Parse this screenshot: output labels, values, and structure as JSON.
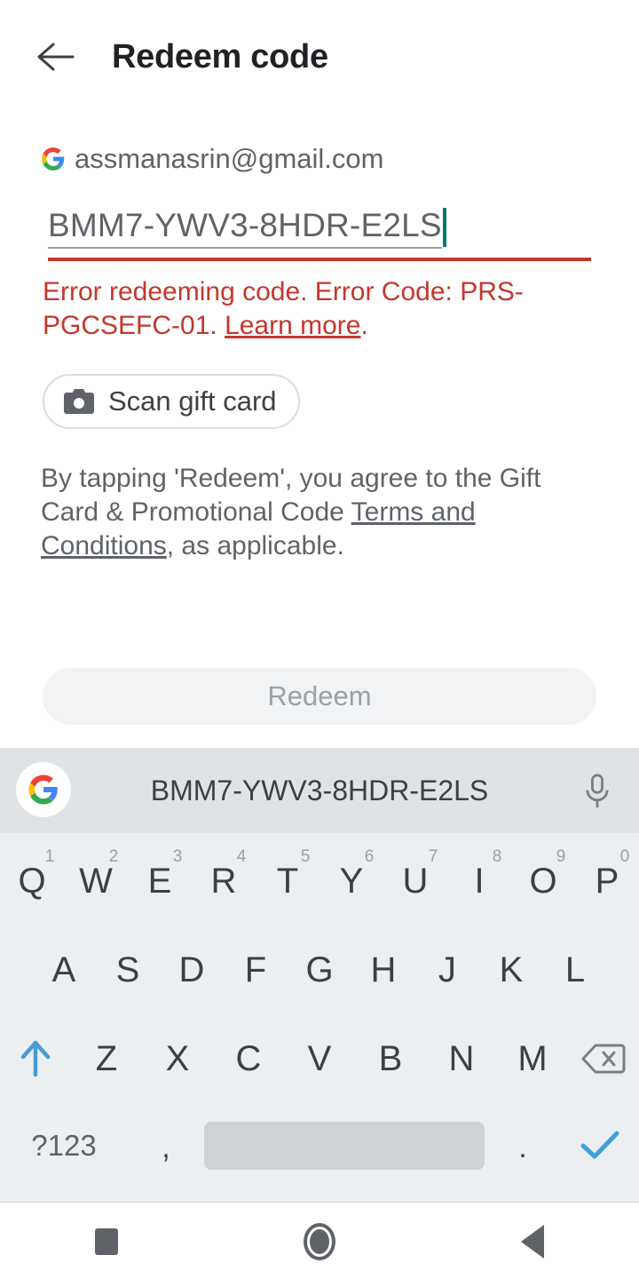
{
  "appbar": {
    "back_icon": "arrow-back-icon",
    "title": "Redeem code"
  },
  "account": {
    "logo": "google-g-icon",
    "email": "assmanasrin@gmail.com"
  },
  "code_field": {
    "value": "BMM7-YWV3-8HDR-E2LS",
    "placeholder": "Enter code",
    "caret_color": "#00796b",
    "error_underline_color": "#c5372c"
  },
  "error": {
    "message_before_link": "Error redeeming code. Error Code: PRS-PGCSEFC-01. ",
    "link_label": "Learn more",
    "message_after_link": ".",
    "color": "#c5372c"
  },
  "scan_button": {
    "icon": "camera-icon",
    "label": "Scan gift card"
  },
  "terms": {
    "text_before_link": "By tapping 'Redeem', you agree to the Gift Card & Promotional Code ",
    "link_label": "Terms and Conditions",
    "text_after_link": ", as applicable."
  },
  "redeem_button": {
    "label": "Redeem",
    "enabled": "false"
  },
  "keyboard": {
    "suggestion": "BMM7-YWV3-8HDR-E2LS",
    "logo": "google-g-icon",
    "mic_icon": "microphone-icon",
    "row1": [
      {
        "key": "Q",
        "num": "1"
      },
      {
        "key": "W",
        "num": "2"
      },
      {
        "key": "E",
        "num": "3"
      },
      {
        "key": "R",
        "num": "4"
      },
      {
        "key": "T",
        "num": "5"
      },
      {
        "key": "Y",
        "num": "6"
      },
      {
        "key": "U",
        "num": "7"
      },
      {
        "key": "I",
        "num": "8"
      },
      {
        "key": "O",
        "num": "9"
      },
      {
        "key": "P",
        "num": "0"
      }
    ],
    "row2": [
      "A",
      "S",
      "D",
      "F",
      "G",
      "H",
      "J",
      "K",
      "L"
    ],
    "row3": [
      "Z",
      "X",
      "C",
      "V",
      "B",
      "N",
      "M"
    ],
    "shift_icon": "shift-arrow-up-icon",
    "shift_color": "#4a9bd4",
    "backspace_icon": "backspace-icon",
    "row4": {
      "symbols_label": "?123",
      "comma_label": ",",
      "space_label": "",
      "period_label": ".",
      "enter_icon": "checkmark-icon",
      "enter_color": "#3ea0e0"
    }
  },
  "navbar": {
    "recents_icon": "square-recents-icon",
    "home_icon": "circle-home-icon",
    "back_icon": "triangle-back-icon"
  }
}
